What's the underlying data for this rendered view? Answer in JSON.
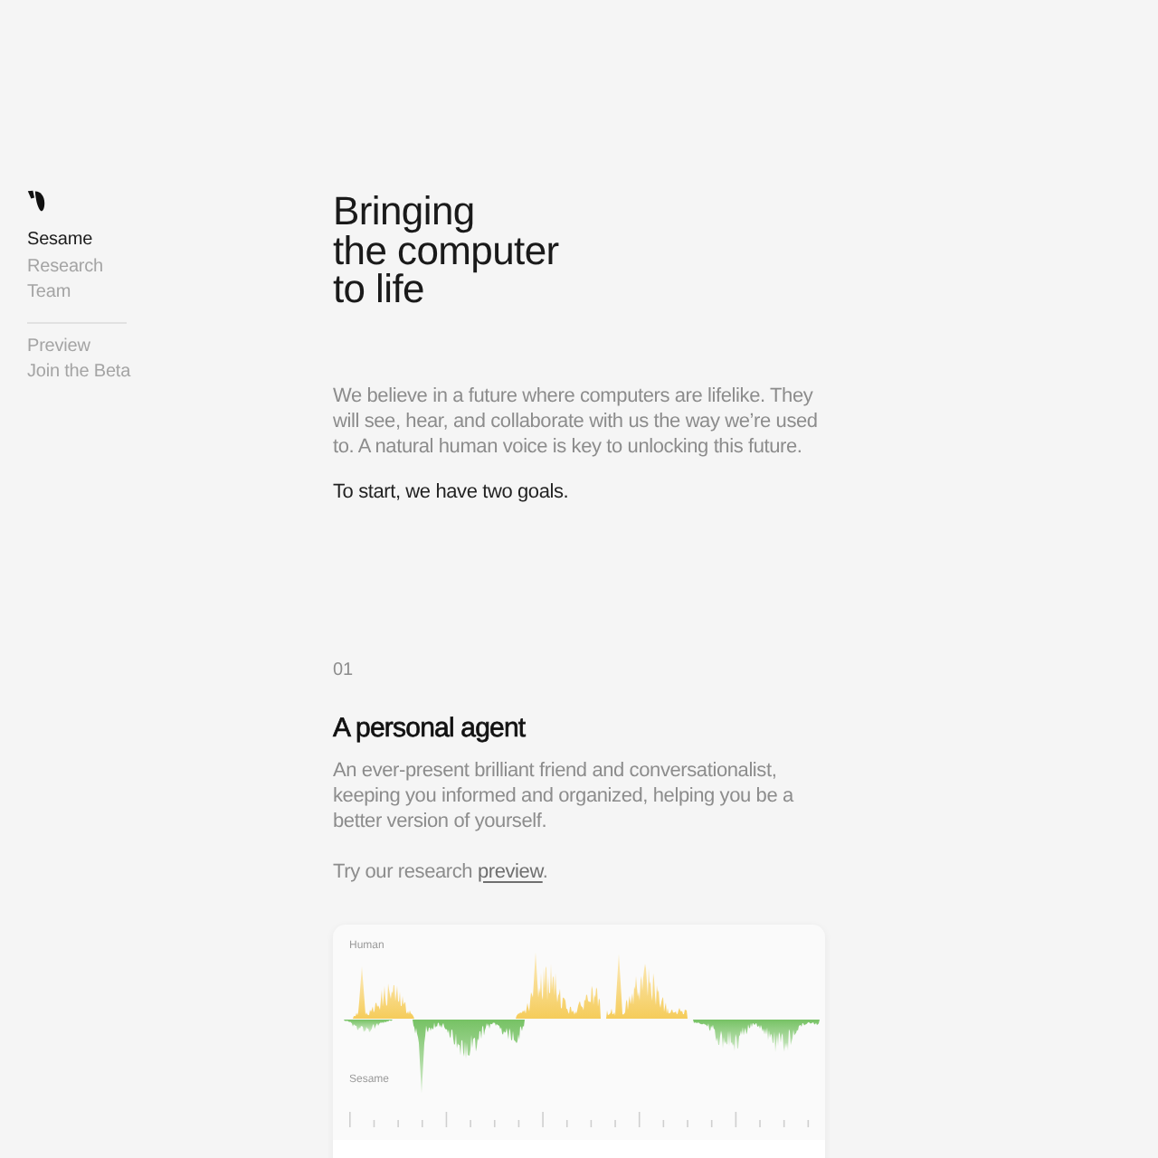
{
  "sidebar": {
    "groups": [
      {
        "items": [
          {
            "label": "Sesame",
            "selected": true
          },
          {
            "label": "Research",
            "selected": false
          },
          {
            "label": "Team",
            "selected": false
          }
        ]
      },
      {
        "items": [
          {
            "label": "Preview",
            "selected": false
          },
          {
            "label": "Join the Beta",
            "selected": false
          }
        ]
      }
    ]
  },
  "hero": {
    "title_lines": [
      "Bringing",
      "the computer",
      "to life"
    ],
    "intro": "We believe in a future where computers are lifelike. They will see, hear, and collaborate with us the way we’re used to. A natural human voice is key to unlocking this future.",
    "lead": "To start, we have two goals."
  },
  "goals": [
    {
      "number": "01",
      "title": "A personal agent",
      "description": "An ever-present brilliant friend and conversationalist, keeping you informed and organized, helping you be a better version of yourself.",
      "cta": {
        "text": "Try our research ",
        "link": "preview",
        "after": "."
      },
      "demo": {
        "tracks": [
          {
            "label": "Human"
          },
          {
            "label": "Sesame"
          }
        ]
      }
    }
  ]
}
